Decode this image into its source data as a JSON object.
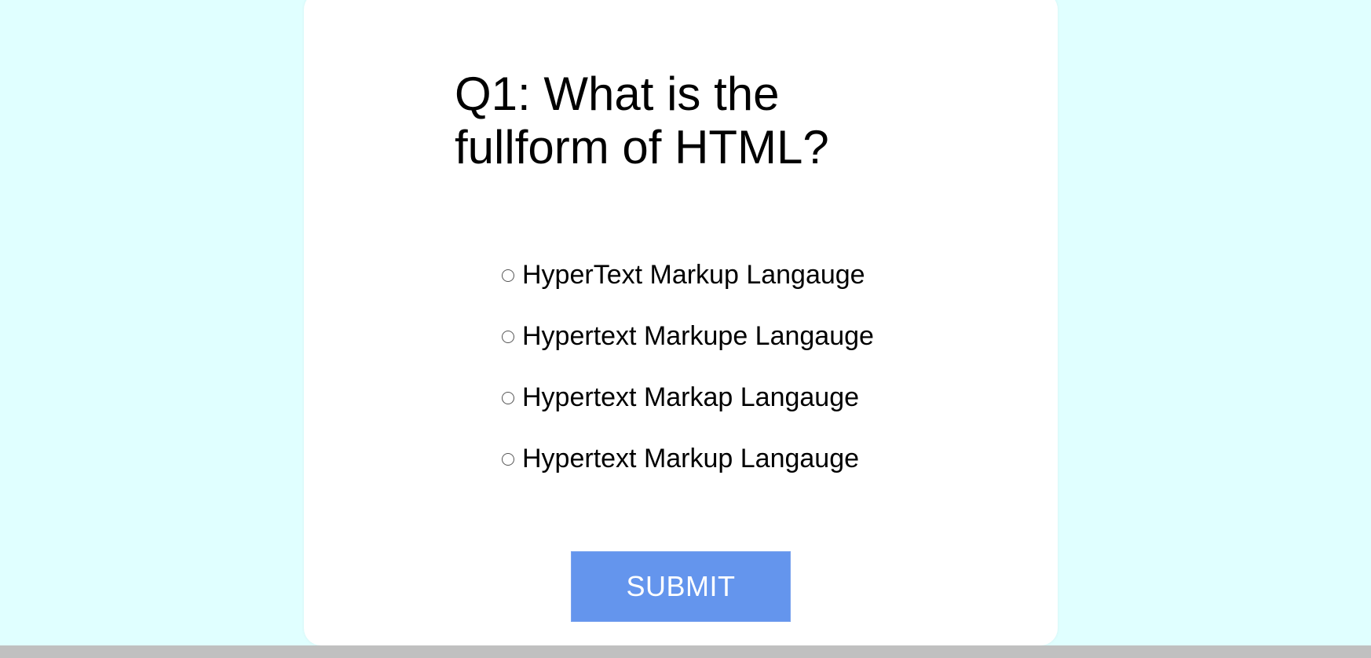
{
  "quiz": {
    "question": "Q1: What is the fullform of HTML?",
    "options": [
      "HyperText Markup Langauge",
      "Hypertext Markupe Langauge",
      "Hypertext Markap Langauge",
      "Hypertext Markup Langauge"
    ],
    "submit_label": "SUBMIT"
  },
  "colors": {
    "background": "#e0ffff",
    "card": "#ffffff",
    "submit_button": "#6495ed",
    "scrollbar": "#c0c0c0"
  }
}
